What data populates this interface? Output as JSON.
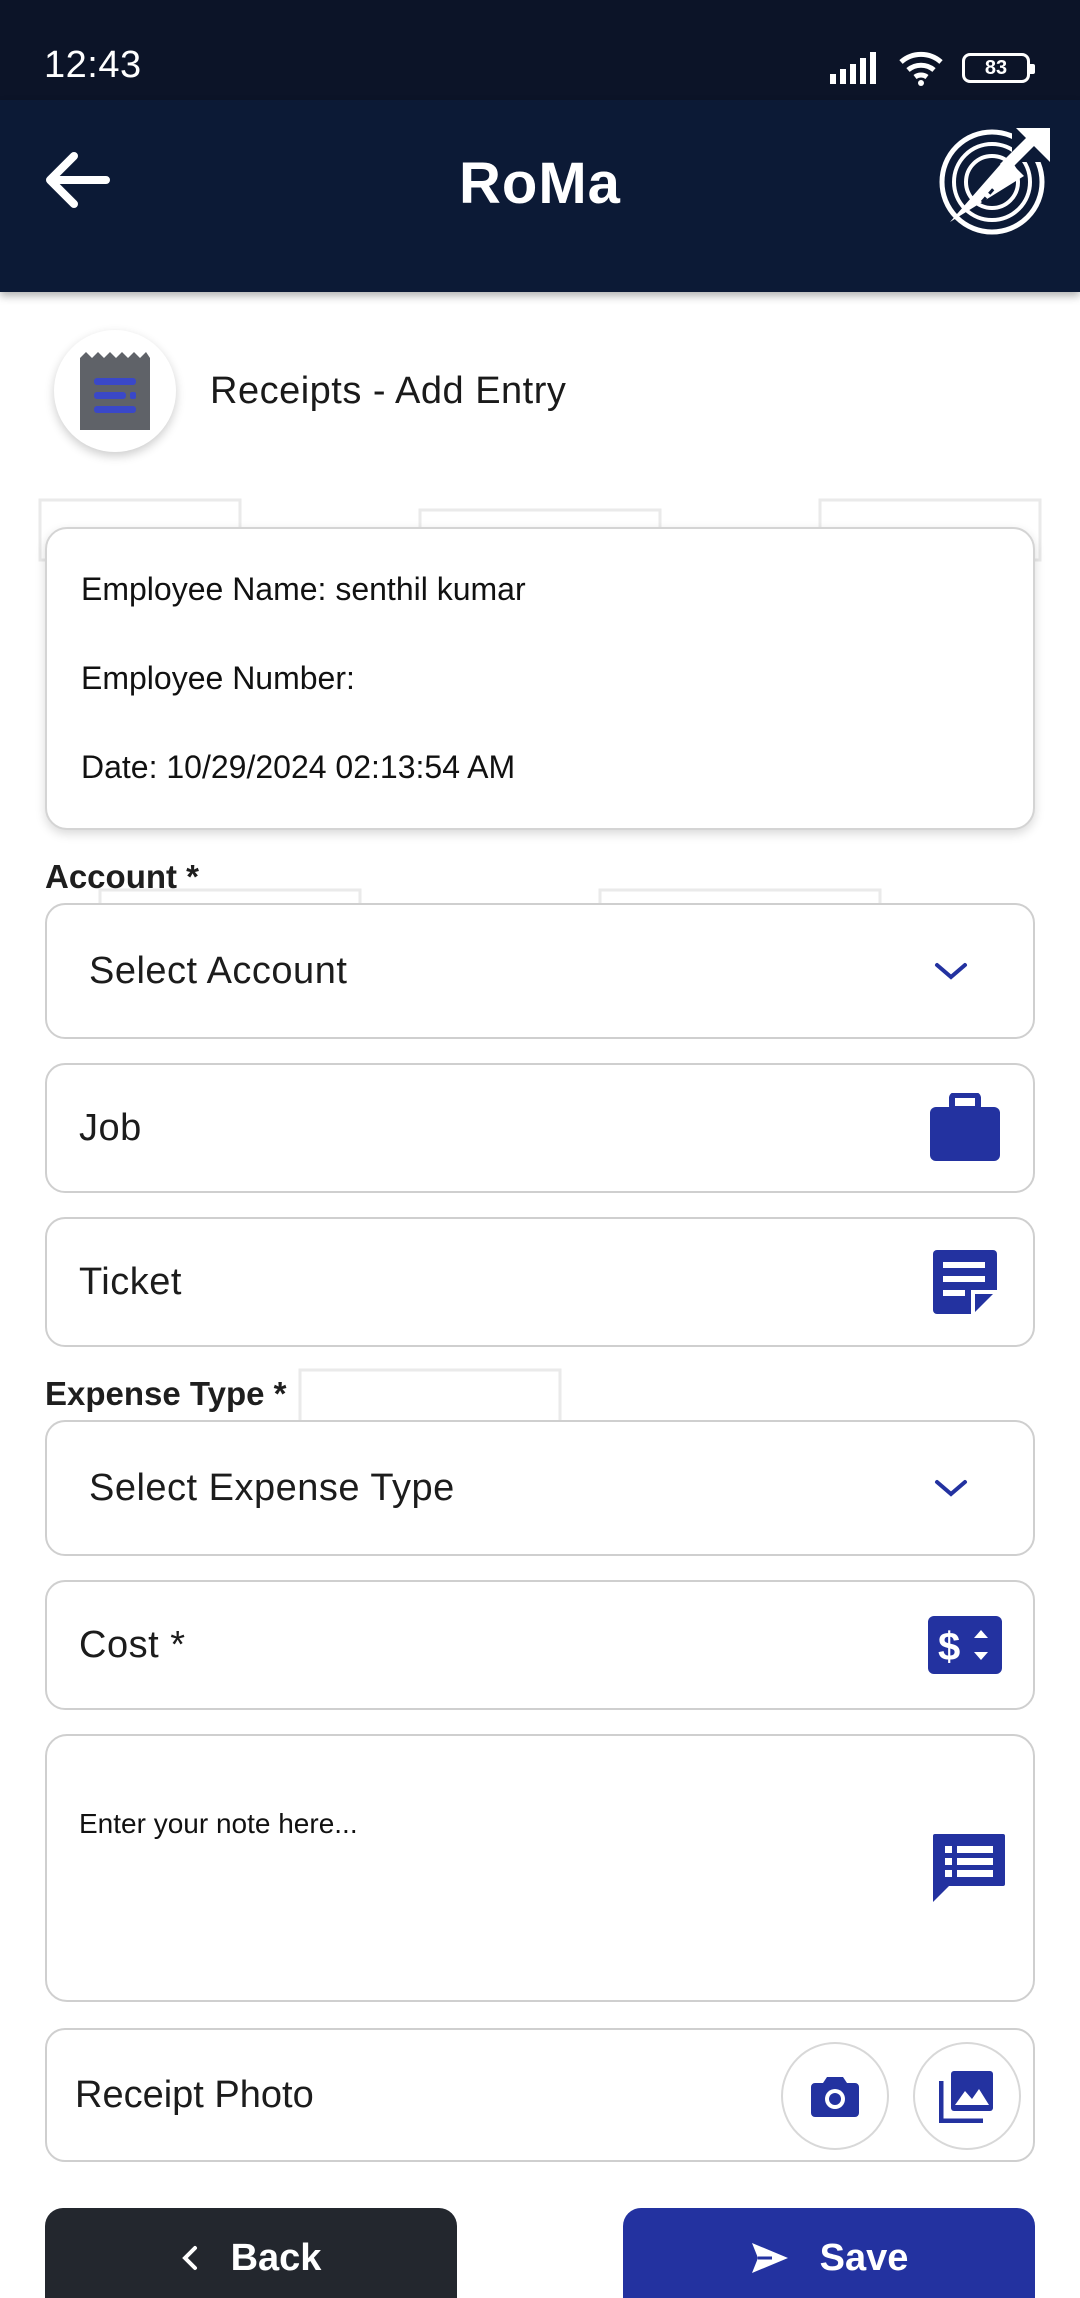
{
  "status_bar": {
    "time": "12:43",
    "battery": "83"
  },
  "app_bar": {
    "title": "RoMa"
  },
  "page": {
    "title": "Receipts - Add Entry"
  },
  "info": {
    "employee_name": "Employee Name: senthil kumar",
    "employee_number": "Employee Number:",
    "date": "Date: 10/29/2024 02:13:54 AM"
  },
  "form": {
    "account_label": "Account *",
    "account_value": "Select Account",
    "job_placeholder": "Job",
    "ticket_placeholder": "Ticket",
    "expense_type_label": "Expense Type *",
    "expense_type_value": "Select Expense Type",
    "cost_placeholder": "Cost *",
    "note_placeholder": "Enter your note here...",
    "receipt_photo_label": "Receipt Photo"
  },
  "actions": {
    "back_label": "Back",
    "save_label": "Save"
  },
  "icons": {
    "accent": "#2332a0",
    "dark_bar": "#0c1a36"
  }
}
